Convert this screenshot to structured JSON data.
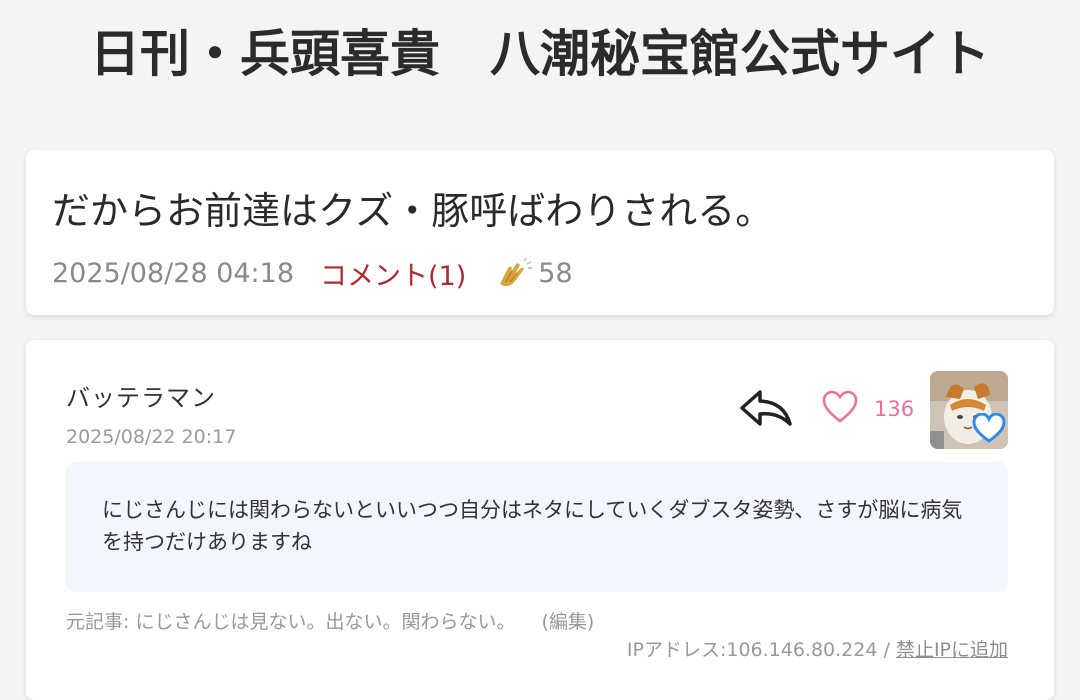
{
  "site": {
    "title": "日刊・兵頭喜貴　八潮秘宝館公式サイト"
  },
  "article": {
    "title": "だからお前達はクズ・豚呼ばわりされる。",
    "date": "2025/08/28 04:18",
    "comments_label": "コメント(1)",
    "clap_count": "58",
    "clap_icon": "clap-icon",
    "colors": {
      "comment_link": "#b3282d",
      "clap": "#d9a441"
    }
  },
  "comment": {
    "author": "バッテラマン",
    "date": "2025/08/22 20:17",
    "like_count": "136",
    "body": "にじさんじには関わらないといいつつ自分はネタにしていくダブスタ姿勢、さすが脳に病気を持つだけありますね",
    "source_prefix": "元記事: ",
    "source_title": "にじさんじは見ない。出ない。関わらない。",
    "edit_label": "(編集)",
    "ip_label": "IPアドレス:106.146.80.224",
    "separator": " / ",
    "ban_ip_label": "禁止IPに追加",
    "icons": {
      "reply": "reply-arrow-icon",
      "like": "heart-outline-icon",
      "avatar_badge": "heart-badge-icon"
    },
    "colors": {
      "like": "#f06e9c",
      "body_bg": "#f3f7fd",
      "badge": "#2a8be8"
    }
  }
}
